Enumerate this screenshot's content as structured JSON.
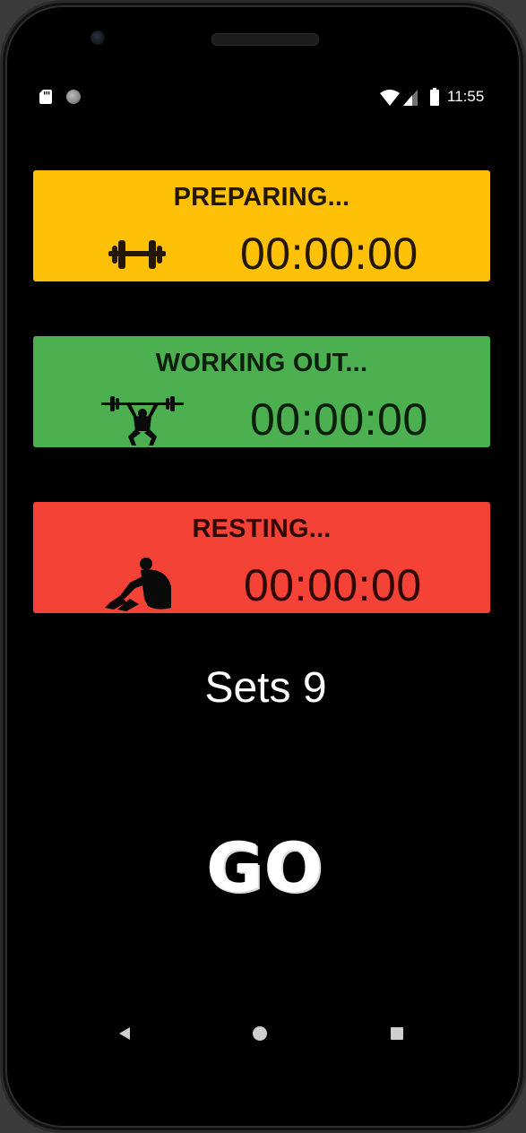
{
  "status_bar": {
    "time": "11:55",
    "icons": [
      "sd-card-icon",
      "notification-dot-icon",
      "wifi-icon",
      "cell-signal-icon",
      "battery-icon"
    ]
  },
  "timers": {
    "preparing": {
      "label": "PREPARING...",
      "time": "00:00:00",
      "icon": "dumbbell-icon",
      "color": "#ffc107"
    },
    "working": {
      "label": "WORKING OUT...",
      "time": "00:00:00",
      "icon": "weightlifter-icon",
      "color": "#4caf50"
    },
    "resting": {
      "label": "RESTING...",
      "time": "00:00:00",
      "icon": "sitting-person-icon",
      "color": "#f44336"
    }
  },
  "sets_label": "Sets 9",
  "go_label": "GO",
  "nav_bar": {
    "icons": [
      "back-icon",
      "home-icon",
      "recents-icon"
    ]
  }
}
